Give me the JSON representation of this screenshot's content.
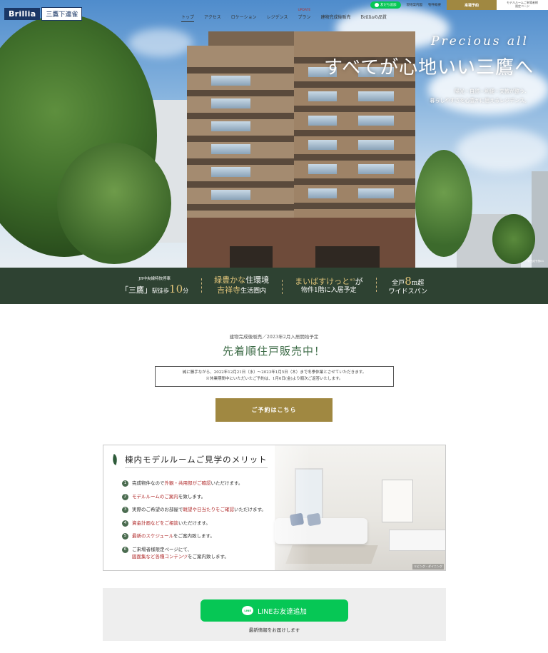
{
  "header": {
    "logo_brand": "Brillia",
    "logo_sub": "三鷹下連雀",
    "nav": [
      {
        "label": "トップ",
        "active": true
      },
      {
        "label": "アクセス"
      },
      {
        "label": "ロケーション"
      },
      {
        "label": "レジデンス"
      },
      {
        "label": "プラン",
        "badge": "UPDATE"
      },
      {
        "label": "建物完成後販売"
      },
      {
        "label": "Brilliaの品質"
      }
    ],
    "line_button": "友だち追加",
    "utility_links": [
      "現地案内図",
      "物件概要"
    ],
    "reserve_label": "来場予約",
    "model_room_label_1": "モデルルームご来場者様",
    "model_room_label_2": "限定ページ"
  },
  "hero": {
    "tagline_en": "Precious all",
    "headline": "すべてが心地いい三鷹へ",
    "desc_1": "陽光・自然・利便・文教が整う、",
    "desc_2": "暮らしやすさを心豊かに思えるレジデンス。",
    "photo_note": "外観完成予想CG"
  },
  "features": {
    "f1_small": "JR中央線特快停車",
    "f1_station": "「三鷹」",
    "f1_walk": "駅徒歩",
    "f1_minutes": "10",
    "f1_unit": "分",
    "f2_line1_a": "緑豊かな",
    "f2_line1_b": "住環境",
    "f2_line2_a": "吉祥寺",
    "f2_line2_b": "生活圏内",
    "f3_line1": "まいばすけっと",
    "f3_sup": "※3",
    "f3_suffix": "が",
    "f3_line2": "物件1階に入居予定",
    "f4_prefix": "全戸",
    "f4_num": "8",
    "f4_unit": "m超",
    "f4_line2": "ワイドスパン"
  },
  "sale": {
    "subtitle": "建物完成後販売／2023年2月入居開始予定",
    "title": "先着順住戸販売中！",
    "notice_1": "誠に勝手ながら、2022年12月21日（水）～2023年1月5日（木）まで冬季休業とさせていただきます。",
    "notice_2": "※休業期間中にいただいたご予約は、1月6日(金)より順次ご返答いたします。",
    "reserve_button": "ご予約はこちら"
  },
  "model_room": {
    "title": "棟内モデルルームご見学のメリット",
    "photo_caption": "リビング・ダイニング",
    "merits": [
      {
        "num": "1",
        "pre": "完成物件なので",
        "hl": "外観・共用部がご確認",
        "post": "いただけます。"
      },
      {
        "num": "2",
        "pre": "",
        "hl": "モデルルームのご案内",
        "post": "を致します。"
      },
      {
        "num": "3",
        "pre": "実際のご希望のお部屋で",
        "hl": "眺望や日当たりをご確認",
        "post": "いただけます。"
      },
      {
        "num": "4",
        "pre": "",
        "hl": "資金計画などをご相談",
        "post": "いただけます。"
      },
      {
        "num": "5",
        "pre": "",
        "hl": "最新のスケジュール",
        "post": "をご案内致します。"
      },
      {
        "num": "6",
        "pre": "ご来場者様限定ページにて、",
        "hl": "",
        "post": ""
      }
    ],
    "merit6_line2_hl": "図面集など各種コンテンツ",
    "merit6_line2_post": "をご案内致します。"
  },
  "line_section": {
    "icon_text": "LINE",
    "button_label": "LINEお友達追加",
    "caption": "最新情報をお届けします"
  },
  "colors": {
    "green_bar": "#2e4232",
    "gold": "#a08841",
    "line_green": "#06c755",
    "accent_red": "#b02a2a",
    "title_green": "#3b6a45"
  }
}
